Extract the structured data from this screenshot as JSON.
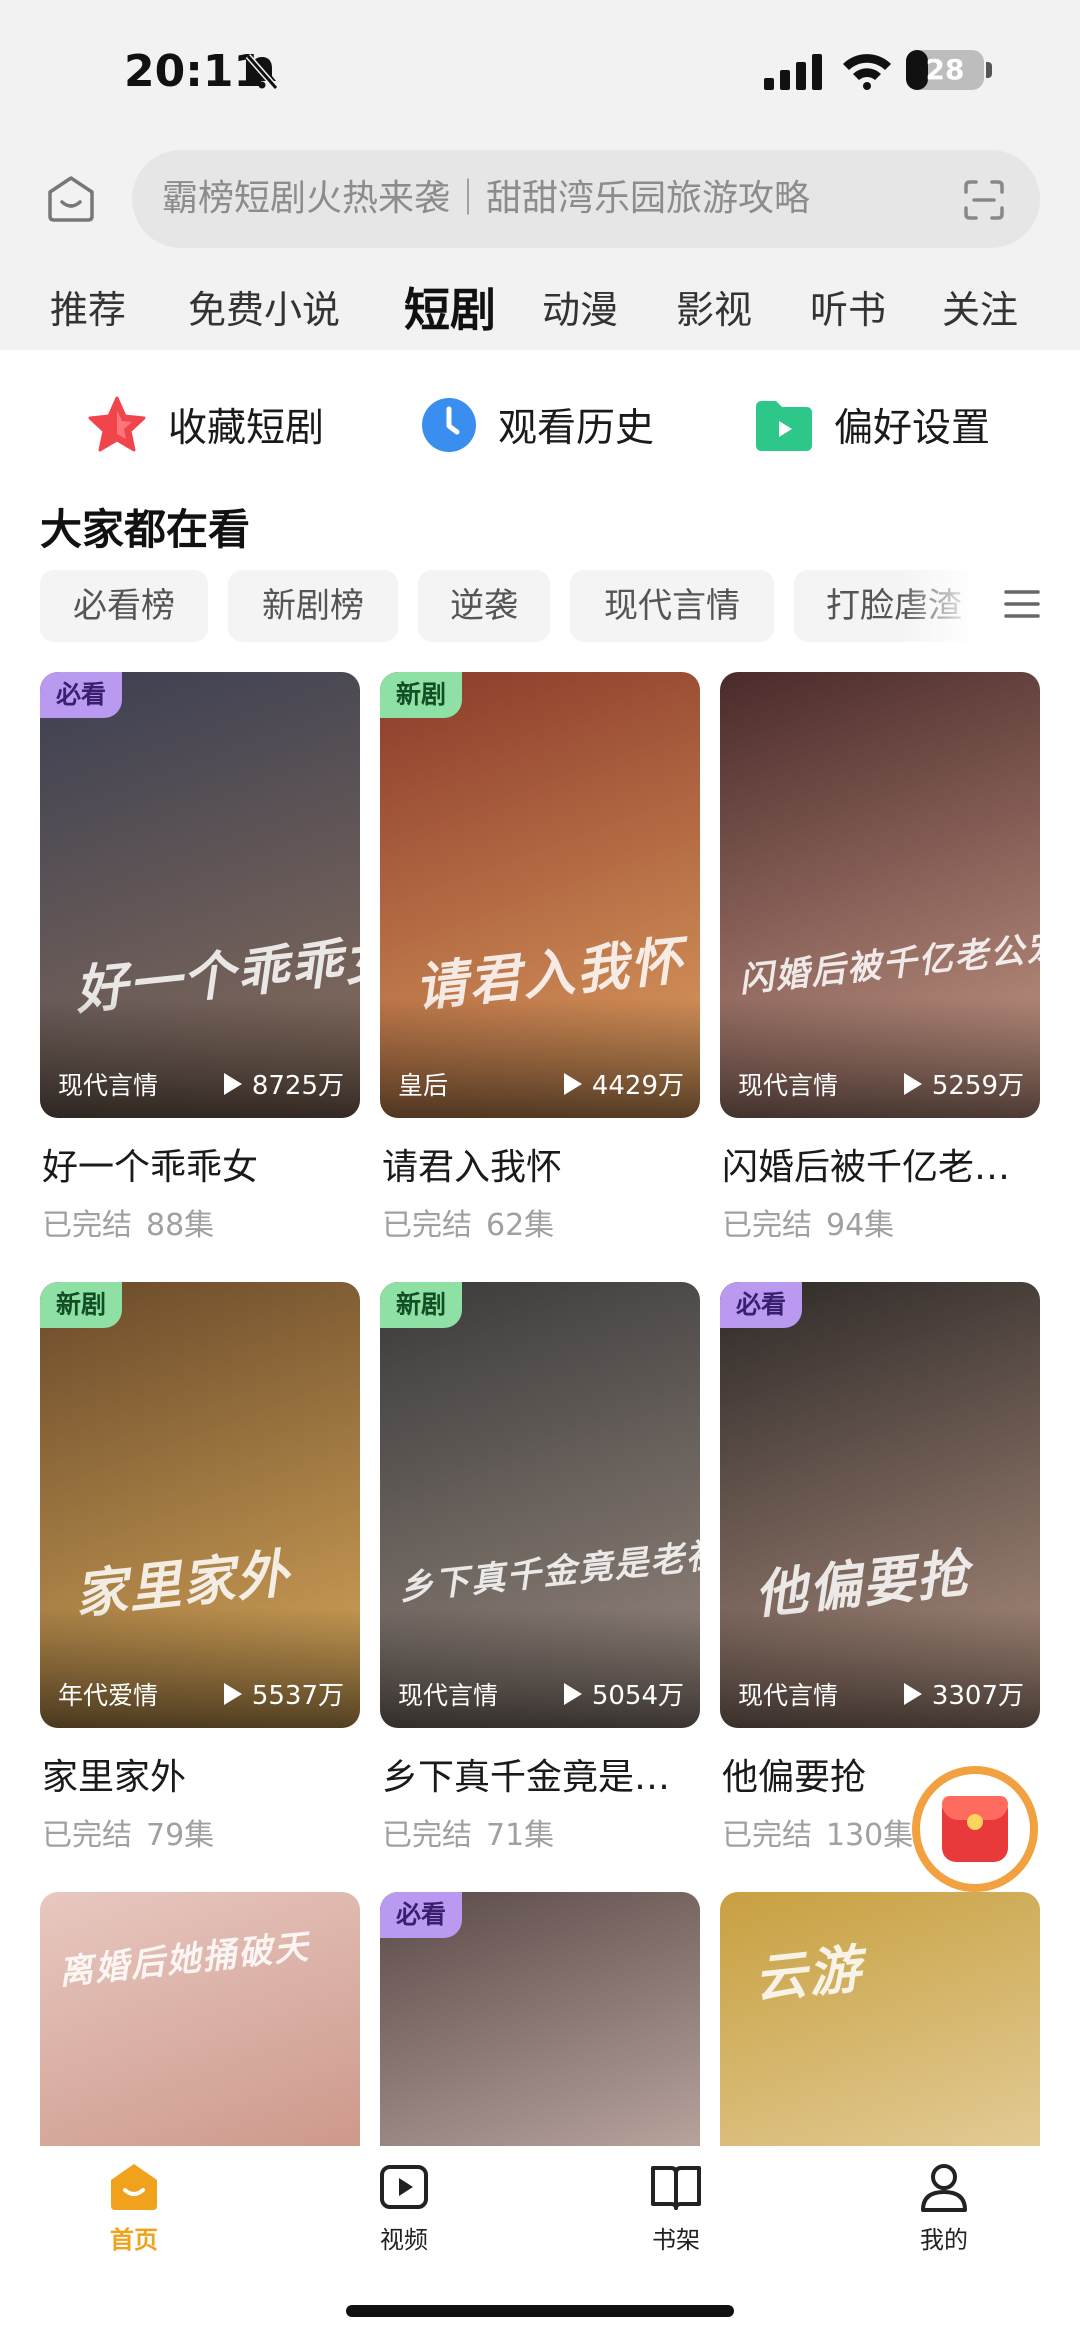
{
  "status_bar": {
    "time": "20:11",
    "battery": "28",
    "battery_level": 0.28
  },
  "search": {
    "placeholder": "霸榜短剧火热来袭｜甜甜湾乐园旅游攻略"
  },
  "tabs": [
    {
      "label": "推荐"
    },
    {
      "label": "免费小说"
    },
    {
      "label": "短剧"
    },
    {
      "label": "动漫"
    },
    {
      "label": "影视"
    },
    {
      "label": "听书"
    },
    {
      "label": "关注"
    }
  ],
  "active_tab": "短剧",
  "shortcuts": [
    {
      "label": "收藏短剧",
      "icon": "star-icon"
    },
    {
      "label": "观看历史",
      "icon": "clock-icon"
    },
    {
      "label": "偏好设置",
      "icon": "folder-icon"
    }
  ],
  "section": {
    "title": "大家都在看"
  },
  "chips": [
    {
      "label": "必看榜"
    },
    {
      "label": "新剧榜"
    },
    {
      "label": "逆袭"
    },
    {
      "label": "现代言情"
    },
    {
      "label": "打脸虐渣"
    }
  ],
  "cards": [
    {
      "badge": "必看",
      "badge_color": "#b99af0",
      "genre": "现代言情",
      "views": "8725万",
      "title": "好一个乖乖女",
      "status": "已完结",
      "episodes": "88集",
      "poster_text": "好一个乖乖女",
      "colors": [
        "#3b3f52",
        "#8a6f5c"
      ]
    },
    {
      "badge": "新剧",
      "badge_color": "#8ee0a5",
      "genre": "皇后",
      "views": "4429万",
      "title": "请君入我怀",
      "status": "已完结",
      "episodes": "62集",
      "poster_text": "请君入我怀",
      "colors": [
        "#8b3a2a",
        "#e0a060"
      ]
    },
    {
      "badge": "",
      "badge_color": "",
      "genre": "现代言情",
      "views": "5259万",
      "title": "闪婚后被千亿老…",
      "status": "已完结",
      "episodes": "94集",
      "poster_text": "闪婚后被千亿老公宠上天",
      "colors": [
        "#4a2a2a",
        "#c89a88"
      ]
    },
    {
      "badge": "新剧",
      "badge_color": "#8ee0a5",
      "genre": "年代爱情",
      "views": "5537万",
      "title": "家里家外",
      "status": "已完结",
      "episodes": "79集",
      "poster_text": "家里家外",
      "colors": [
        "#6a4a2a",
        "#d8a85a"
      ]
    },
    {
      "badge": "新剧",
      "badge_color": "#8ee0a5",
      "genre": "现代言情",
      "views": "5054万",
      "title": "乡下真千金竟是…",
      "status": "已完结",
      "episodes": "71集",
      "poster_text": "乡下真千金竟是老祖宗",
      "colors": [
        "#3a3a3a",
        "#9a8a80"
      ]
    },
    {
      "badge": "必看",
      "badge_color": "#b99af0",
      "genre": "现代言情",
      "views": "3307万",
      "title": "他偏要抢",
      "status": "已完结",
      "episodes": "130集",
      "poster_text": "他偏要抢",
      "colors": [
        "#2e2a28",
        "#b09080"
      ]
    },
    {
      "badge": "",
      "badge_color": "",
      "poster_text": "离婚后她捅破天",
      "colors": [
        "#e8c8c0",
        "#c08070"
      ]
    },
    {
      "badge": "必看",
      "badge_color": "#b99af0",
      "poster_text": "",
      "colors": [
        "#5a4a48",
        "#e8d0c8"
      ]
    },
    {
      "badge": "",
      "badge_color": "",
      "poster_text": "云游",
      "colors": [
        "#c8a040",
        "#f0e0c0"
      ]
    }
  ],
  "bottom_nav": [
    {
      "label": "首页",
      "icon": "home-icon",
      "active": true
    },
    {
      "label": "视频",
      "icon": "video-icon"
    },
    {
      "label": "书架",
      "icon": "book-icon"
    },
    {
      "label": "我的",
      "icon": "profile-icon"
    }
  ],
  "accent_color": "#f0a21c"
}
